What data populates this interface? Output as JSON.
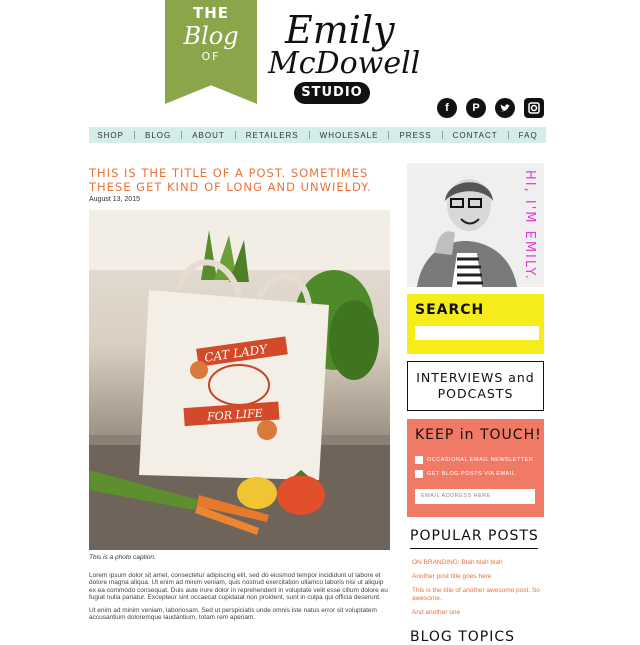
{
  "header": {
    "banner": {
      "line1": "THE",
      "line2": "Blog",
      "line3": "OF"
    },
    "logo": {
      "line1": "Emily",
      "line2": "McDowell",
      "badge": "STUDIO"
    },
    "socials": [
      "facebook-icon",
      "pinterest-icon",
      "twitter-icon",
      "instagram-icon"
    ]
  },
  "nav": {
    "items": [
      "SHOP",
      "BLOG",
      "ABOUT",
      "RETAILERS",
      "WHOLESALE",
      "PRESS",
      "CONTACT",
      "FAQ"
    ]
  },
  "post": {
    "title": "THIS IS THE TITLE OF A POST. SOMETIMES THESE GET KIND OF LONG AND UNWIELDY.",
    "date": "August 13, 2015",
    "photo": {
      "tote_text_1": "CAT LADY",
      "tote_text_2": "FOR LIFE"
    },
    "caption": "This is a photo caption.",
    "paragraphs": [
      "Lorem ipsum dolor sit amet, consectetur adipiscing elit, sed do eiusmod tempor incididunt ut labore et dolore magna aliqua. Ut enim ad minim veniam, quis nostrud exercitation ullamco laboris nisi ut aliquip ex ea commodo consequat. Duis aute irure dolor in reprehenderit in voluptate velit esse cillum dolore eu fugiat nulla pariatur. Excepteur sint occaecat cupidatat non proident, sunt in culpa qui officia deserunt.",
      "Ut enim ad minim veniam, laboriosam. Sed ut perspiciatis unde omnis iste natus error sit voluptatem accusantium doloremque laudantium, totam rem aperiam."
    ]
  },
  "sidebar": {
    "hi_text": "HI, I'M EMILY.",
    "search_label": "SEARCH",
    "interviews": {
      "line1": "INTERVIEWS and",
      "line2": "PODCASTS"
    },
    "keep_in_touch": {
      "title": "KEEP in TOUCH!",
      "option1": "OCCASIONAL EMAIL NEWSLETTER",
      "option2": "GET BLOG POSTS VIA EMAIL",
      "email_placeholder": "EMAIL ADDRESS HERE"
    },
    "popular_title": "POPULAR POSTS",
    "popular_posts": [
      "ON BRANDING: Blah blah blah",
      "Another post title goes here",
      "This is the title of another awesome post. So awesome.",
      "And another one"
    ],
    "blog_topics": "BLOG TOPICS"
  },
  "colors": {
    "accent": "#e8733a",
    "banner_green": "#8aa54a",
    "nav_bg": "#d4ede8",
    "search_yellow": "#f5ec1a",
    "keep_coral": "#f07a66",
    "hi_pink": "#e53bd1"
  }
}
